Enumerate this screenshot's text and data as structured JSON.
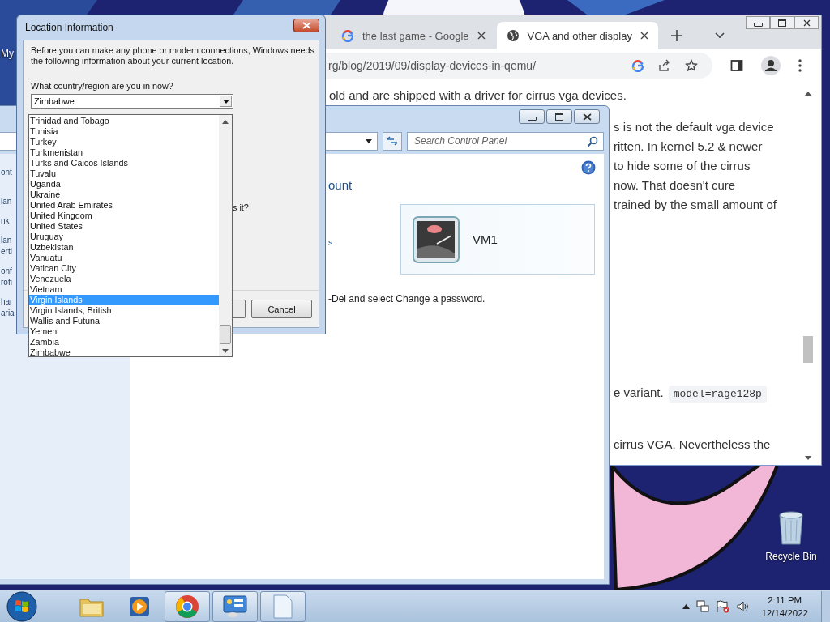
{
  "desktop": {
    "icon_labels": [
      "My"
    ],
    "recycle_bin": {
      "label": "Recycle Bin"
    }
  },
  "browser": {
    "tabs": [
      {
        "title": "the last game - Google",
        "selected": false
      },
      {
        "title": "VGA and other display",
        "selected": true
      }
    ],
    "url": "rg/blog/2019/09/display-devices-in-qemu/",
    "paragraphs": [
      {
        "lines": [
          {
            "text": "old and are shipped with a driver for cirrus vga devices."
          }
        ]
      },
      {
        "lines": [
          {
            "text": "s is not the default vga device"
          },
          {
            "text": "ritten. In kernel 5.2 & newer"
          },
          {
            "text": "to hide some of the cirrus"
          },
          {
            "text": "now. That doesn't cure"
          },
          {
            "text": "trained by the small amount of"
          }
        ]
      },
      {
        "lines": [
          {
            "text": "e variant.",
            "code": "model=rage128p"
          }
        ]
      },
      {
        "lines": [
          {
            "text": "cirrus VGA. Nevertheless the"
          }
        ]
      }
    ]
  },
  "control_panel": {
    "sidebar_links": [
      {
        "lines": [
          "ont"
        ]
      },
      {
        "lines": [
          "lan"
        ]
      },
      {
        "lines": [
          "nk"
        ]
      },
      {
        "lines": [
          "lan",
          "erti"
        ]
      },
      {
        "lines": [
          "onf",
          "rofi"
        ]
      },
      {
        "lines": [
          "har",
          "aria"
        ]
      }
    ],
    "search": {
      "placeholder": "Search Control Panel"
    },
    "heading": "ount",
    "link": "s",
    "account": {
      "name": "VM1"
    },
    "note": "-Del and select Change a password."
  },
  "dialog": {
    "title": "Location Information",
    "intro": "Before you can make any phone or modem connections, Windows needs the following information about your current location.",
    "question": "What country/region are you in now?",
    "country": "Zimbabwe",
    "countries": [
      {
        "name": "Trinidad and Tobago",
        "selected": false
      },
      {
        "name": "Tunisia",
        "selected": false
      },
      {
        "name": "Turkey",
        "selected": false
      },
      {
        "name": "Turkmenistan",
        "selected": false
      },
      {
        "name": "Turks and Caicos Islands",
        "selected": false
      },
      {
        "name": "Tuvalu",
        "selected": false
      },
      {
        "name": "Uganda",
        "selected": false
      },
      {
        "name": "Ukraine",
        "selected": false
      },
      {
        "name": "United Arab Emirates",
        "selected": false
      },
      {
        "name": "United Kingdom",
        "selected": false
      },
      {
        "name": "United States",
        "selected": false
      },
      {
        "name": "Uruguay",
        "selected": false
      },
      {
        "name": "Uzbekistan",
        "selected": false
      },
      {
        "name": "Vanuatu",
        "selected": false
      },
      {
        "name": "Vatican City",
        "selected": false
      },
      {
        "name": "Venezuela",
        "selected": false
      },
      {
        "name": "Vietnam",
        "selected": false
      },
      {
        "name": "Virgin Islands",
        "selected": true
      },
      {
        "name": "Virgin Islands, British",
        "selected": false
      },
      {
        "name": "Wallis and Futuna",
        "selected": false
      },
      {
        "name": "Yemen",
        "selected": false
      },
      {
        "name": "Zambia",
        "selected": false
      },
      {
        "name": "Zimbabwe",
        "selected": false
      }
    ],
    "fragment": "s it?",
    "cancel": "Cancel"
  },
  "taskbar": {
    "apps": [
      {
        "kind": "folder",
        "running": false
      },
      {
        "kind": "media",
        "running": false
      },
      {
        "kind": "browser",
        "running": true
      },
      {
        "kind": "control-panel",
        "running": true
      },
      {
        "kind": "document",
        "running": true
      }
    ],
    "time": "2:11 PM",
    "date": "12/14/2022"
  }
}
